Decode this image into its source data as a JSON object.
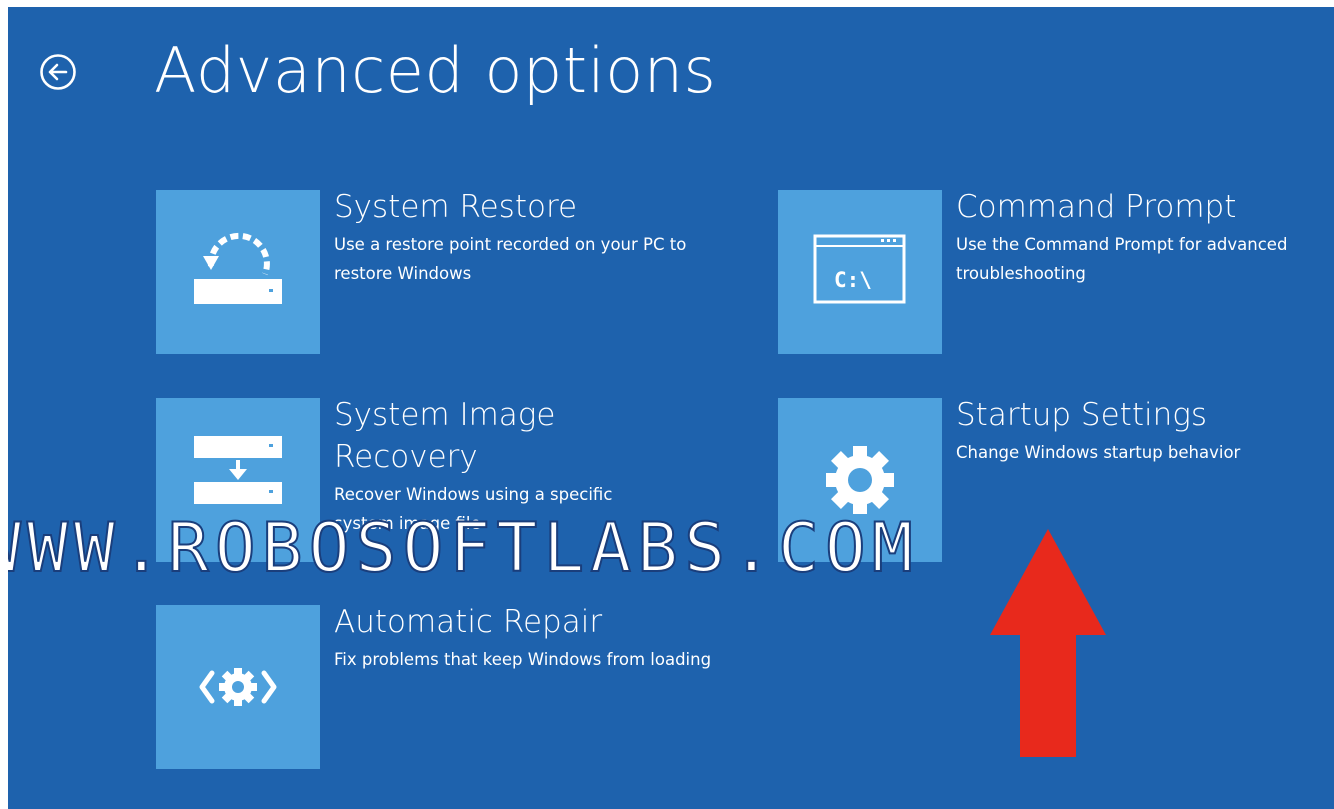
{
  "page": {
    "title": "Advanced options"
  },
  "options": [
    {
      "id": "system-restore",
      "title": "System Restore",
      "description": "Use a restore point recorded on your PC to restore Windows",
      "icon": "system-restore-icon"
    },
    {
      "id": "command-prompt",
      "title": "Command Prompt",
      "description": "Use the Command Prompt for advanced troubleshooting",
      "icon": "command-prompt-icon",
      "icon_text": "C:\\"
    },
    {
      "id": "system-image-recovery",
      "title": "System Image Recovery",
      "description": "Recover Windows using a specific system image file",
      "icon": "system-image-recovery-icon"
    },
    {
      "id": "startup-settings",
      "title": "Startup Settings",
      "description": "Change Windows startup behavior",
      "icon": "gear-icon"
    },
    {
      "id": "automatic-repair",
      "title": "Automatic Repair",
      "description": "Fix problems that keep Windows from loading",
      "icon": "automatic-repair-icon"
    }
  ],
  "watermark": "WWW.ROBOSOFTLABS.COM",
  "colors": {
    "background": "#1e62ad",
    "tile": "#4ea1dd",
    "text": "#ffffff",
    "annotation_arrow": "#e8291c"
  }
}
